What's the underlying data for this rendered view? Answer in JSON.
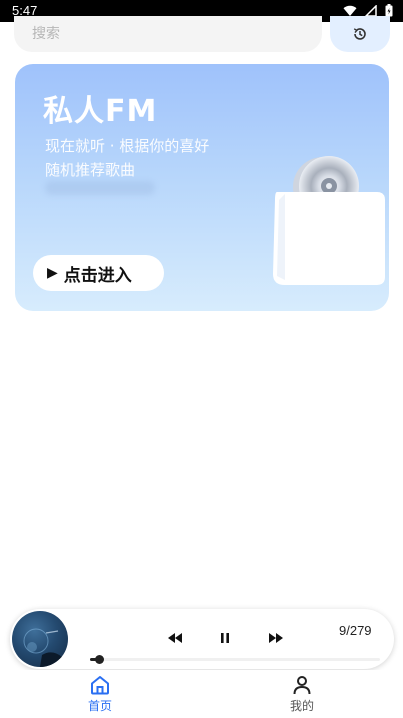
{
  "status_bar": {
    "time": "5:47"
  },
  "search": {
    "placeholder": "搜索"
  },
  "fm_card": {
    "title": "私人FM",
    "subtitle_line1": "现在就听 · 根据你的喜好",
    "subtitle_line2": "随机推荐歌曲",
    "enter_label": "点击进入"
  },
  "mini_player": {
    "track_position": "9/279",
    "progress": 0.03
  },
  "bottom_nav": {
    "items": [
      {
        "label": "首页",
        "icon": "home-icon",
        "active": true
      },
      {
        "label": "我的",
        "icon": "person-icon",
        "active": false
      }
    ]
  },
  "colors": {
    "accent": "#2a6ff2",
    "card_gradient_top": "#9fc2fb",
    "card_gradient_bottom": "#d7ecfd"
  }
}
